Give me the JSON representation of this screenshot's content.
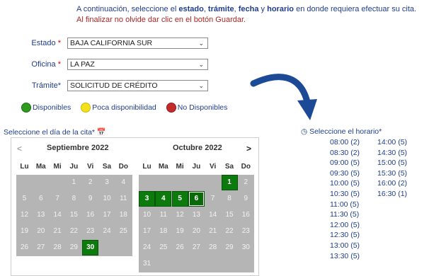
{
  "intro": {
    "prefix": "A continuación, seleccione el ",
    "b1": "estado",
    "sep1": ", ",
    "b2": "trámite",
    "sep2": ", ",
    "b3": "fecha",
    "sep3": " y ",
    "b4": "horario",
    "suffix": " en donde requiera efectuar su cita.",
    "warning": "Al finalizar no olvide dar clic en el botón Guardar."
  },
  "form": {
    "estado_label": "Estado",
    "estado_value": "BAJA CALIFORNIA SUR",
    "oficina_label": "Oficina",
    "oficina_value": "LA PAZ",
    "tramite_label": "Trámite",
    "tramite_value": "SOLICITUD DE CRÉDITO",
    "required_mark": "*"
  },
  "legend": {
    "available": "Disponibles",
    "few": "Poca disponibilidad",
    "none": "No Disponibles",
    "colors": {
      "available": "#2e9b1e",
      "few": "#f4e11a",
      "none": "#c42b2b"
    }
  },
  "calendar": {
    "label": "Seleccione el día de la cita*",
    "prev": "<",
    "next": ">",
    "weekdays": [
      "Lu",
      "Ma",
      "Mi",
      "Ju",
      "Vi",
      "Sa",
      "Do"
    ],
    "months": [
      {
        "title": "Septiembre 2022",
        "days": [
          "1",
          "2",
          "3",
          "4",
          "5",
          "6",
          "7",
          "8",
          "9",
          "10",
          "11",
          "12",
          "13",
          "14",
          "15",
          "16",
          "17",
          "18",
          "19",
          "20",
          "21",
          "22",
          "23",
          "24",
          "25",
          "26",
          "27",
          "28",
          "29",
          "30"
        ],
        "available": [
          "30"
        ]
      },
      {
        "title": "Octubre 2022",
        "days": [
          "1",
          "2",
          "3",
          "4",
          "5",
          "6",
          "7",
          "8",
          "9",
          "10",
          "11",
          "12",
          "13",
          "14",
          "15",
          "16",
          "17",
          "18",
          "19",
          "20",
          "21",
          "22",
          "23",
          "24",
          "25",
          "26",
          "27",
          "28",
          "29",
          "30",
          "31"
        ],
        "available": [
          "1",
          "3",
          "4",
          "5",
          "6"
        ],
        "selected": "6"
      }
    ]
  },
  "schedule": {
    "label": "Seleccione el horario*",
    "col1": [
      "08:00 (2)",
      "08:30 (2)",
      "09:00 (5)",
      "09:30 (5)",
      "10:00 (5)",
      "10:30 (5)",
      "11:00 (5)",
      "11:30 (5)",
      "12:00 (5)",
      "12:30 (5)",
      "13:00 (5)",
      "13:30 (5)"
    ],
    "col2": [
      "14:00 (5)",
      "14:30 (5)",
      "15:00 (5)",
      "15:30 (5)",
      "16:00 (2)",
      "16:30 (1)"
    ]
  }
}
